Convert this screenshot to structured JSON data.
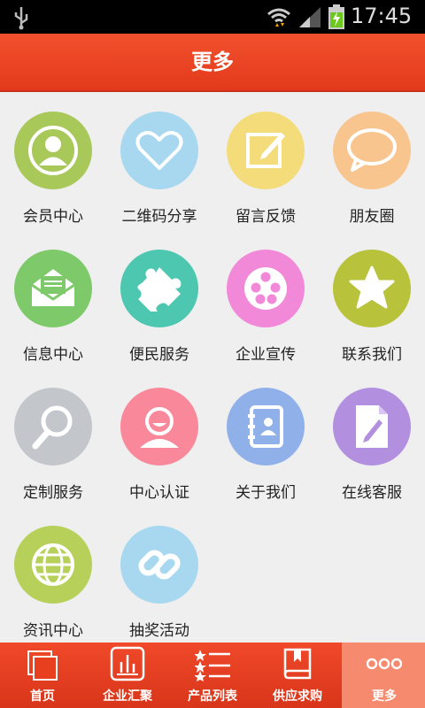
{
  "status": {
    "time": "17:45"
  },
  "header": {
    "title": "更多"
  },
  "items": [
    {
      "label": "会员中心",
      "icon": "user-icon",
      "color": "#a8c85a"
    },
    {
      "label": "二维码分享",
      "icon": "heart-icon",
      "color": "#a8d8f0"
    },
    {
      "label": "留言反馈",
      "icon": "note-edit-icon",
      "color": "#f5dc7a"
    },
    {
      "label": "朋友圈",
      "icon": "speech-bubble-icon",
      "color": "#f8c58e"
    },
    {
      "label": "信息中心",
      "icon": "envelope-icon",
      "color": "#7ec96a"
    },
    {
      "label": "便民服务",
      "icon": "puzzle-icon",
      "color": "#4ec7b0"
    },
    {
      "label": "企业宣传",
      "icon": "film-reel-icon",
      "color": "#f288d8"
    },
    {
      "label": "联系我们",
      "icon": "star-icon",
      "color": "#b8c23a"
    },
    {
      "label": "定制服务",
      "icon": "magnifier-icon",
      "color": "#c3c7cc"
    },
    {
      "label": "中心认证",
      "icon": "smiley-user-icon",
      "color": "#f8889a"
    },
    {
      "label": "关于我们",
      "icon": "address-book-icon",
      "color": "#8fb0e8"
    },
    {
      "label": "在线客服",
      "icon": "document-edit-icon",
      "color": "#b38fe0"
    },
    {
      "label": "资讯中心",
      "icon": "globe-icon",
      "color": "#b6d05a"
    },
    {
      "label": "抽奖活动",
      "icon": "link-icon",
      "color": "#a8d8f0"
    }
  ],
  "tabs": [
    {
      "label": "首页",
      "icon": "home-pages-icon"
    },
    {
      "label": "企业汇聚",
      "icon": "bar-chart-icon"
    },
    {
      "label": "产品列表",
      "icon": "list-stars-icon"
    },
    {
      "label": "供应求购",
      "icon": "book-icon"
    },
    {
      "label": "更多",
      "icon": "more-dots-icon"
    }
  ],
  "colors": {
    "accent": "#e8401f",
    "active_tab": "#f58a6e"
  }
}
